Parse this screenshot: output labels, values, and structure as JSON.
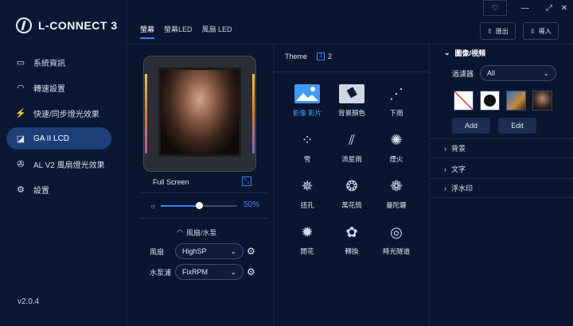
{
  "app": {
    "title": "L-CONNECT 3",
    "version": "v2.0.4"
  },
  "sidebar": {
    "items": [
      {
        "label": "系統資訊",
        "icon": "monitor-icon"
      },
      {
        "label": "轉速設置",
        "icon": "gauge-icon"
      },
      {
        "label": "快速/同步燈光效果",
        "icon": "bolt-icon"
      },
      {
        "label": "GA II LCD",
        "icon": "lcd-icon"
      },
      {
        "label": "AL V2 風扇燈光效果",
        "icon": "fan-icon"
      },
      {
        "label": "設置",
        "icon": "gear-icon"
      }
    ],
    "active_index": 3
  },
  "topbar": {
    "tabs": [
      "螢幕",
      "螢幕LED",
      "風扇 LED"
    ],
    "active_tab": 0,
    "export_label": "匯出",
    "import_label": "導入"
  },
  "preview": {
    "mode_label": "Full Screen",
    "brightness_label": "50%",
    "brightness": 0.5
  },
  "fan_pump": {
    "title": "風扇/水泵",
    "fan_label": "風扇",
    "fan_value": "HighSP",
    "pump_label": "水泵浦",
    "pump_value": "FixRPM"
  },
  "theme": {
    "label": "Theme",
    "page_current": "1",
    "page_next": "2",
    "items": [
      {
        "label": "影像 影片",
        "icon": "image-icon",
        "active": true
      },
      {
        "label": "背景顏色",
        "icon": "paint-icon"
      },
      {
        "label": "下雨",
        "icon": "rain-icon"
      },
      {
        "label": "雪",
        "icon": "snow-icon"
      },
      {
        "label": "流星雨",
        "icon": "meteor-icon"
      },
      {
        "label": "煙火",
        "icon": "firework-icon"
      },
      {
        "label": "扭孔",
        "icon": "swirl-icon"
      },
      {
        "label": "萬花筒",
        "icon": "kaleidoscope-icon"
      },
      {
        "label": "曼陀羅",
        "icon": "mandala-icon"
      },
      {
        "label": "開花",
        "icon": "bloom-icon"
      },
      {
        "label": "轉換",
        "icon": "transform-icon"
      },
      {
        "label": "時光隧道",
        "icon": "tunnel-icon"
      }
    ]
  },
  "media": {
    "section_title": "圖像/視頻",
    "filter_label": "過濾器",
    "filter_value": "All",
    "add_label": "Add",
    "edit_label": "Edit",
    "sections": [
      "背景",
      "文字",
      "浮水印"
    ]
  },
  "colors": {
    "accent": "#3b82f6",
    "active_nav": "#1d3f7a",
    "bg": "#0a1630"
  }
}
